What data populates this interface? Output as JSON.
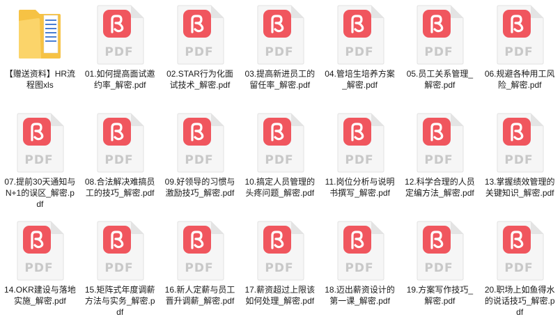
{
  "colors": {
    "pdf_badge": "#f0565e",
    "pdf_text": "#c8c8c8",
    "page_bg": "#f6f6f6",
    "folder": "#f6c244",
    "folder_front": "#fbd46a"
  },
  "pdf_badge_text": "PDF",
  "files": [
    {
      "name": "【赠送资料】HR流程图xls",
      "type": "folder",
      "icon": "folder-icon"
    },
    {
      "name": "01.如何提高面试邀约率_解密.pdf",
      "type": "pdf",
      "icon": "pdf-icon"
    },
    {
      "name": "02.STAR行为化面试技术_解密.pdf",
      "type": "pdf",
      "icon": "pdf-icon"
    },
    {
      "name": "03.提高新进员工的留任率_解密.pdf",
      "type": "pdf",
      "icon": "pdf-icon"
    },
    {
      "name": "04.管培生培养方案_解密.pdf",
      "type": "pdf",
      "icon": "pdf-icon"
    },
    {
      "name": "05.员工关系管理_解密.pdf",
      "type": "pdf",
      "icon": "pdf-icon"
    },
    {
      "name": "06.规避各种用工风险_解密.pdf",
      "type": "pdf",
      "icon": "pdf-icon"
    },
    {
      "name": "07.提前30天通知与N+1的误区_解密.pdf",
      "type": "pdf",
      "icon": "pdf-icon"
    },
    {
      "name": "08.合法解决难搞员工的技巧_解密.pdf",
      "type": "pdf",
      "icon": "pdf-icon"
    },
    {
      "name": "09.好领导的习惯与激励技巧_解密.pdf",
      "type": "pdf",
      "icon": "pdf-icon"
    },
    {
      "name": "10.搞定人员管理的头疼问题_解密.pdf",
      "type": "pdf",
      "icon": "pdf-icon"
    },
    {
      "name": "11.岗位分析与说明书撰写_解密.pdf",
      "type": "pdf",
      "icon": "pdf-icon"
    },
    {
      "name": "12.科学合理的人员定编方法_解密.pdf",
      "type": "pdf",
      "icon": "pdf-icon"
    },
    {
      "name": "13.掌握绩效管理的关键知识_解密.pdf",
      "type": "pdf",
      "icon": "pdf-icon"
    },
    {
      "name": "14.OKR建设与落地实施_解密.pdf",
      "type": "pdf",
      "icon": "pdf-icon"
    },
    {
      "name": "15.矩阵式年度调薪方法与实务_解密.pdf",
      "type": "pdf",
      "icon": "pdf-icon"
    },
    {
      "name": "16.新人定薪与员工晋升调薪_解密.pdf",
      "type": "pdf",
      "icon": "pdf-icon"
    },
    {
      "name": "17.薪资超过上限该如何处理_解密.pdf",
      "type": "pdf",
      "icon": "pdf-icon"
    },
    {
      "name": "18.迈出薪资设计的第一课_解密.pdf",
      "type": "pdf",
      "icon": "pdf-icon"
    },
    {
      "name": "19.方案写作技巧_解密.pdf",
      "type": "pdf",
      "icon": "pdf-icon"
    },
    {
      "name": "20.职场上如鱼得水的说话技巧_解密.pdf",
      "type": "pdf",
      "icon": "pdf-icon"
    }
  ]
}
